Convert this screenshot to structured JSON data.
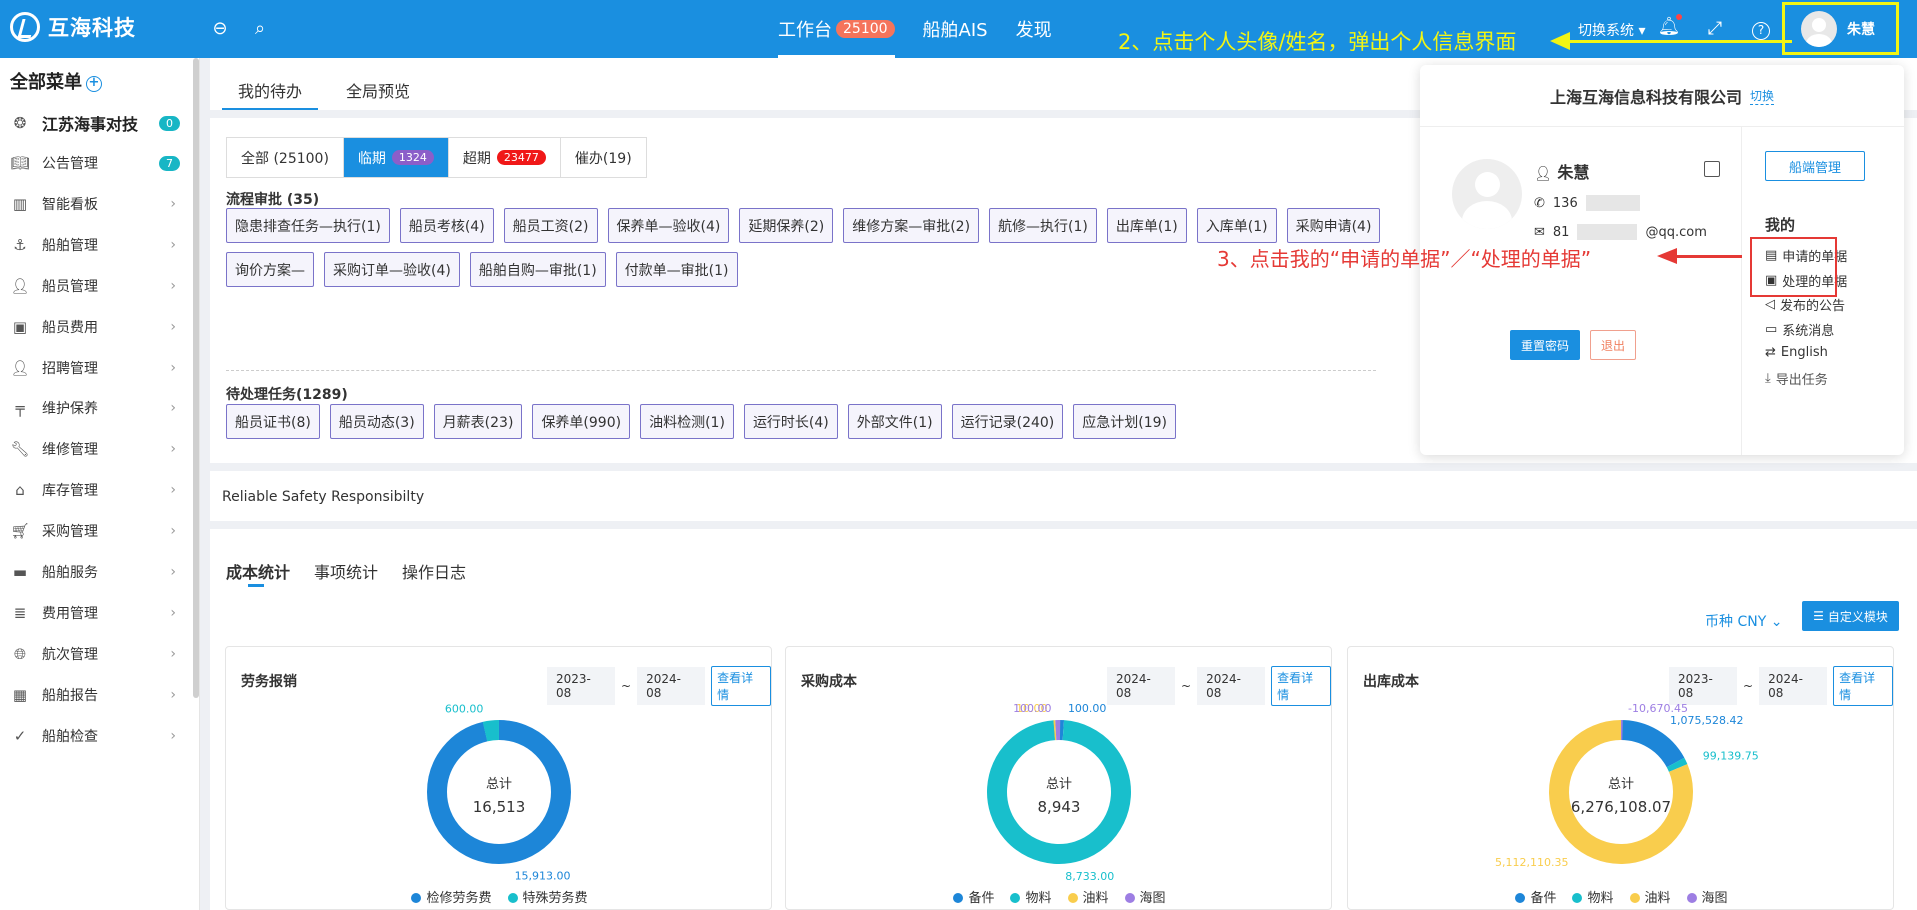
{
  "app": {
    "logo_text": "互海科技"
  },
  "topnav": {
    "workbench": "工作台",
    "workbench_count": "25100",
    "ais": "船舶AIS",
    "discover": "发现",
    "switch_system": "切换系统",
    "user_name": "朱慧"
  },
  "annotations": {
    "step2": "2、点击个人头像/姓名，弹出个人信息界面",
    "step3": "3、点击我的“申请的单据”／“处理的单据”"
  },
  "sidebar": {
    "title": "全部菜单",
    "company": "江苏海事对技",
    "company_badge": "0",
    "items": [
      {
        "label": "公告管理",
        "icon": "book-icon",
        "badge": "7"
      },
      {
        "label": "智能看板",
        "icon": "bar-chart-icon"
      },
      {
        "label": "船舶管理",
        "icon": "anchor-icon"
      },
      {
        "label": "船员管理",
        "icon": "user-icon"
      },
      {
        "label": "船员费用",
        "icon": "wallet-icon"
      },
      {
        "label": "招聘管理",
        "icon": "user-search-icon"
      },
      {
        "label": "维护保养",
        "icon": "paint-icon"
      },
      {
        "label": "维修管理",
        "icon": "wrench-icon"
      },
      {
        "label": "库存管理",
        "icon": "warehouse-icon"
      },
      {
        "label": "采购管理",
        "icon": "cart-icon"
      },
      {
        "label": "船舶服务",
        "icon": "roller-icon"
      },
      {
        "label": "费用管理",
        "icon": "database-icon"
      },
      {
        "label": "航次管理",
        "icon": "globe-icon"
      },
      {
        "label": "船舶报告",
        "icon": "calendar-icon"
      },
      {
        "label": "船舶检查",
        "icon": "check-circle-icon"
      }
    ]
  },
  "main_tabs": [
    "我的待办",
    "全局预览"
  ],
  "filter_tabs": [
    {
      "label": "全部 (25100)",
      "badge": ""
    },
    {
      "label": "临期",
      "badge": "1324"
    },
    {
      "label": "超期",
      "badge": "23477"
    },
    {
      "label": "催办(19)",
      "badge": ""
    }
  ],
  "approval": {
    "title": "流程审批 (35)",
    "chips": [
      "隐患排查任务—执行(1)",
      "船员考核(4)",
      "船员工资(2)",
      "保养单—验收(4)",
      "延期保养(2)",
      "维修方案—审批(2)",
      "航修—执行(1)",
      "出库单(1)",
      "入库单(1)",
      "采购申请(4)",
      "询价方案—",
      "采购订单—验收(4)",
      "船舶自购—审批(1)",
      "付款单—审批(1)"
    ]
  },
  "pending": {
    "title": "待处理任务(1289)",
    "chips": [
      "船员证书(8)",
      "船员动态(3)",
      "月薪表(23)",
      "保养单(990)",
      "油料检测(1)",
      "运行时长(4)",
      "外部文件(1)",
      "运行记录(240)",
      "应急计划(19)"
    ]
  },
  "motto": "Reliable Safety Responsibilty",
  "stats": {
    "tabs": [
      "成本统计",
      "事项统计",
      "操作日志"
    ],
    "currency": "币种 CNY",
    "custom_button": "自定义模块",
    "view_detail": "查看详情",
    "total_label": "总计"
  },
  "popup": {
    "company": "上海互海信息科技有限公司",
    "switch": "切换",
    "name": "朱慧",
    "phone": "136",
    "email_prefix": "81",
    "email_suffix": "@qq.com",
    "reset_password": "重置密码",
    "logout": "退出",
    "shore_manage": "船端管理",
    "my_title": "我的",
    "menu": [
      "申请的单据",
      "处理的单据",
      "发布的公告",
      "系统消息",
      "English",
      "导出任务"
    ]
  },
  "colors": {
    "primary": "#1a8fe0",
    "annotation_yellow": "#f2f514",
    "annotation_red": "#e53935"
  },
  "chart_data": [
    {
      "type": "pie",
      "title": "劳务报销",
      "date_range": [
        "2023-08",
        "2024-08"
      ],
      "total": "16,513",
      "series": [
        {
          "name": "检修劳务费",
          "value": 15913.0,
          "label": "15,913.00",
          "color": "#1d86d8"
        },
        {
          "name": "特殊劳务费",
          "value": 600.0,
          "label": "600.00",
          "color": "#18bfcc"
        }
      ]
    },
    {
      "type": "pie",
      "title": "采购成本",
      "date_range": [
        "2024-08",
        "2024-08"
      ],
      "total": "8,943",
      "series": [
        {
          "name": "备件",
          "value": 100.0,
          "label": "100.00",
          "color": "#1d86d8"
        },
        {
          "name": "物料",
          "value": 8733.0,
          "label": "8,733.00",
          "color": "#18bfcc"
        },
        {
          "name": "油料",
          "value": 10.0,
          "label": "10.00",
          "color": "#f9cd4d"
        },
        {
          "name": "海图",
          "value": 100.0,
          "label": "100.00",
          "color": "#9d7ee3"
        }
      ]
    },
    {
      "type": "pie",
      "title": "出库成本",
      "date_range": [
        "2023-08",
        "2024-08"
      ],
      "total": "6,276,108.07",
      "series": [
        {
          "name": "备件",
          "value": 1075528.42,
          "label": "1,075,528.42",
          "color": "#1d86d8"
        },
        {
          "name": "物料",
          "value": 99139.75,
          "label": "99,139.75",
          "color": "#18bfcc"
        },
        {
          "name": "油料",
          "value": 5112110.35,
          "label": "5,112,110.35",
          "color": "#f9cd4d"
        },
        {
          "name": "海图",
          "value": -10670.45,
          "label": "-10,670.45",
          "color": "#9d7ee3"
        }
      ]
    }
  ]
}
